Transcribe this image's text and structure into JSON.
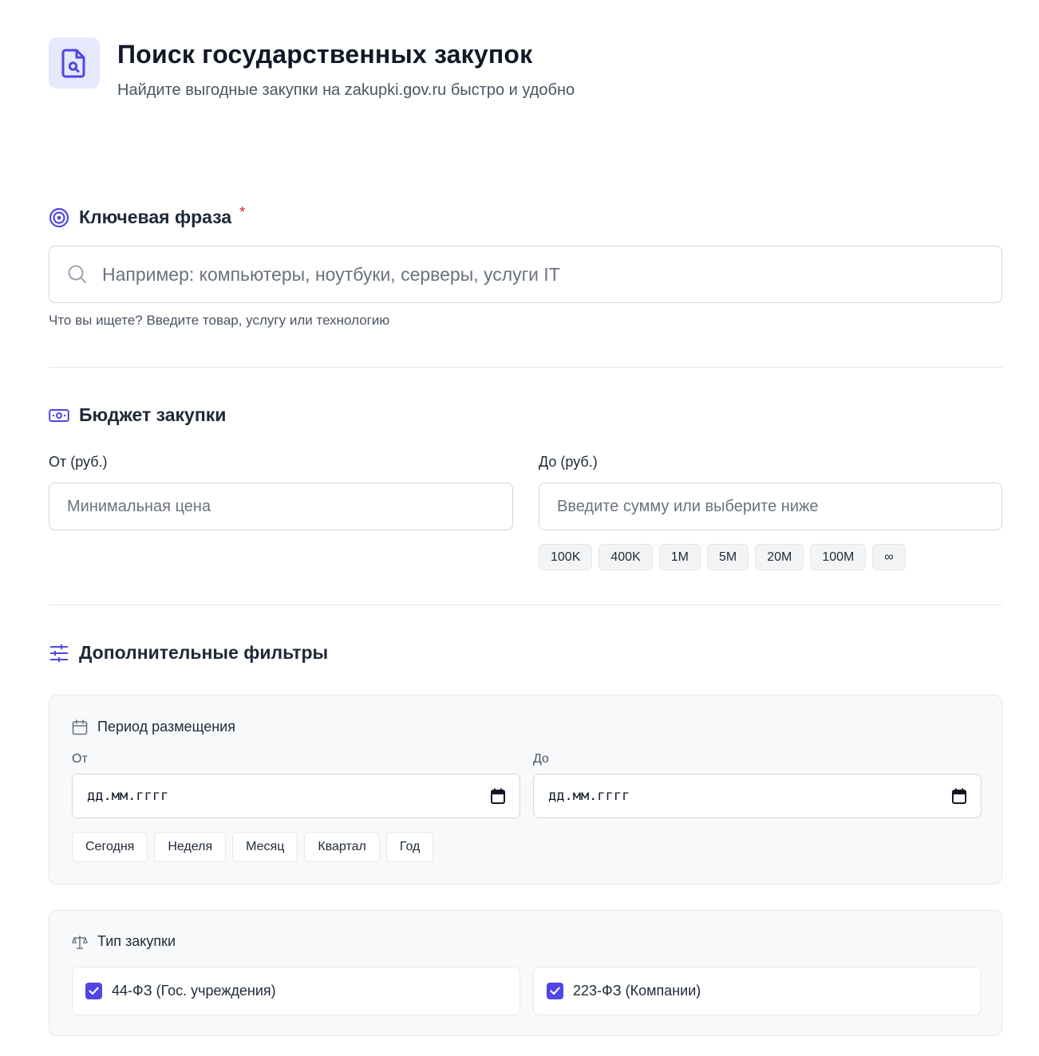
{
  "header": {
    "title": "Поиск государственных закупок",
    "subtitle": "Найдите выгодные закупки на zakupki.gov.ru быстро и удобно"
  },
  "keyword": {
    "title": "Ключевая фраза",
    "required_mark": "*",
    "placeholder": "Например: компьютеры, ноутбуки, серверы, услуги IT",
    "hint": "Что вы ищете? Введите товар, услугу или технологию"
  },
  "budget": {
    "title": "Бюджет закупки",
    "from_label": "От (руб.)",
    "from_placeholder": "Минимальная цена",
    "to_label": "До (руб.)",
    "to_placeholder": "Введите сумму или выберите ниже",
    "chips": [
      "100K",
      "400K",
      "1M",
      "5M",
      "20M",
      "100M",
      "∞"
    ]
  },
  "filters": {
    "title": "Дополнительные фильтры",
    "period": {
      "title": "Период размещения",
      "from_label": "От",
      "to_label": "До",
      "date_placeholder": "дд.мм.гггг",
      "buttons": [
        "Сегодня",
        "Неделя",
        "Месяц",
        "Квартал",
        "Год"
      ]
    },
    "type": {
      "title": "Тип закупки",
      "options": [
        {
          "label": "44-ФЗ (Гос. учреждения)",
          "checked": true
        },
        {
          "label": "223-ФЗ (Компании)",
          "checked": true
        }
      ]
    }
  },
  "colors": {
    "accent": "#4f46e5",
    "required": "#dc2626"
  }
}
